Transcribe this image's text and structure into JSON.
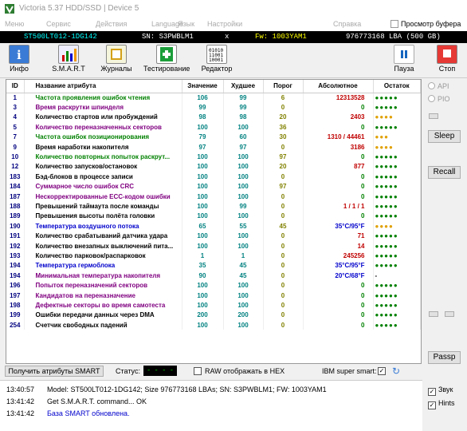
{
  "window": {
    "title": "Victoria 5.37 HDD/SSD | Device 5"
  },
  "menu": {
    "items": [
      "Меню",
      "Сервис",
      "Действия",
      "Язык",
      "Language",
      "Настройки",
      "Справка"
    ],
    "viewer_label": "Просмотр буфера"
  },
  "device": {
    "model": "ST500LT012-1DG142",
    "serial": "SN: S3PWBLM1",
    "close": "x",
    "firmware": "Fw: 1003YAM1",
    "capacity": "976773168 LBA (500 GB)"
  },
  "toolbar": {
    "info": "Инфо",
    "smart": "S.M.A.R.T",
    "journals": "Журналы",
    "testing": "Тестирование",
    "editor": "Редактор",
    "pause": "Пауза",
    "stop": "Стоп"
  },
  "smart_table": {
    "headers": [
      "ID",
      "Название атрибута",
      "Значение",
      "Худшее",
      "Порог",
      "Абсолютное",
      "Остаток"
    ],
    "rows": [
      {
        "id": "1",
        "name": "Частота проявления ошибок чтения",
        "value": "106",
        "worst": "99",
        "threshold": "6",
        "raw": "12313528",
        "status": "●●●●●",
        "name_color": "#008000",
        "status_color": "#008000"
      },
      {
        "id": "3",
        "name": "Время раскрутки шпинделя",
        "value": "99",
        "worst": "99",
        "threshold": "0",
        "raw": "0",
        "status": "●●●●●",
        "name_color": "#800080",
        "status_color": "#008000"
      },
      {
        "id": "4",
        "name": "Количество стартов или пробуждений",
        "value": "98",
        "worst": "98",
        "threshold": "20",
        "raw": "2403",
        "status": "●●●●",
        "name_color": "#000000",
        "status_color": "#e0a000"
      },
      {
        "id": "5",
        "name": "Количество переназначенных секторов",
        "value": "100",
        "worst": "100",
        "threshold": "36",
        "raw": "0",
        "status": "●●●●●",
        "name_color": "#800080",
        "status_color": "#008000"
      },
      {
        "id": "7",
        "name": "Частота ошибок позиционирования",
        "value": "79",
        "worst": "60",
        "threshold": "30",
        "raw": "1310 / 44461",
        "status": "●●●",
        "name_color": "#008000",
        "status_color": "#e0a000"
      },
      {
        "id": "9",
        "name": "Время наработки накопителя",
        "value": "97",
        "worst": "97",
        "threshold": "0",
        "raw": "3186",
        "status": "●●●●",
        "name_color": "#000000",
        "status_color": "#e0a000"
      },
      {
        "id": "10",
        "name": "Количество повторных попыток раскрут...",
        "value": "100",
        "worst": "100",
        "threshold": "97",
        "raw": "0",
        "status": "●●●●●",
        "name_color": "#008000",
        "status_color": "#008000"
      },
      {
        "id": "12",
        "name": "Количество запусков/остановок",
        "value": "100",
        "worst": "100",
        "threshold": "20",
        "raw": "877",
        "status": "●●●●●",
        "name_color": "#000000",
        "status_color": "#008000"
      },
      {
        "id": "183",
        "name": "Бэд-блоков в процессе записи",
        "value": "100",
        "worst": "100",
        "threshold": "0",
        "raw": "0",
        "status": "●●●●●",
        "name_color": "#000000",
        "status_color": "#008000"
      },
      {
        "id": "184",
        "name": "Суммарное число ошибок CRC",
        "value": "100",
        "worst": "100",
        "threshold": "97",
        "raw": "0",
        "status": "●●●●●",
        "name_color": "#800080",
        "status_color": "#008000"
      },
      {
        "id": "187",
        "name": "Нескорректированные ECC-кодом ошибки",
        "value": "100",
        "worst": "100",
        "threshold": "0",
        "raw": "0",
        "status": "●●●●●",
        "name_color": "#800080",
        "status_color": "#008000"
      },
      {
        "id": "188",
        "name": "Превышений таймаута после команды",
        "value": "100",
        "worst": "99",
        "threshold": "0",
        "raw": "1 / 1 / 1",
        "status": "●●●●●",
        "name_color": "#000000",
        "status_color": "#008000"
      },
      {
        "id": "189",
        "name": "Превышения высоты полёта головки",
        "value": "100",
        "worst": "100",
        "threshold": "0",
        "raw": "0",
        "status": "●●●●●",
        "name_color": "#000000",
        "status_color": "#008000"
      },
      {
        "id": "190",
        "name": "Температура воздушного потока",
        "value": "65",
        "worst": "55",
        "threshold": "45",
        "raw": "35°C/95°F",
        "status": "●●●●",
        "name_color": "#0000cc",
        "status_color": "#e0a000"
      },
      {
        "id": "191",
        "name": "Количество срабатываний датчика удара",
        "value": "100",
        "worst": "100",
        "threshold": "0",
        "raw": "71",
        "status": "●●●●●",
        "name_color": "#000000",
        "status_color": "#008000"
      },
      {
        "id": "192",
        "name": "Количество внезапных выключений пита...",
        "value": "100",
        "worst": "100",
        "threshold": "0",
        "raw": "14",
        "status": "●●●●●",
        "name_color": "#000000",
        "status_color": "#008000"
      },
      {
        "id": "193",
        "name": "Количество парковок/распарковок",
        "value": "1",
        "worst": "1",
        "threshold": "0",
        "raw": "245256",
        "status": "●●●●●",
        "name_color": "#000000",
        "status_color": "#008000"
      },
      {
        "id": "194",
        "name": "Температура гермоблока",
        "value": "35",
        "worst": "45",
        "threshold": "0",
        "raw": "35°C/95°F",
        "status": "●●●●●",
        "name_color": "#0000cc",
        "status_color": "#008000"
      },
      {
        "id": "194",
        "name": "Минимальная температура накопителя",
        "value": "90",
        "worst": "45",
        "threshold": "0",
        "raw": "20°C/68°F",
        "status": "-",
        "name_color": "#800080",
        "status_color": "#000000"
      },
      {
        "id": "196",
        "name": "Попыток переназначений секторов",
        "value": "100",
        "worst": "100",
        "threshold": "0",
        "raw": "0",
        "status": "●●●●●",
        "name_color": "#800080",
        "status_color": "#008000"
      },
      {
        "id": "197",
        "name": "Кандидатов на переназначение",
        "value": "100",
        "worst": "100",
        "threshold": "0",
        "raw": "0",
        "status": "●●●●●",
        "name_color": "#800080",
        "status_color": "#008000"
      },
      {
        "id": "198",
        "name": "Дефектные секторы во время самотеста",
        "value": "100",
        "worst": "100",
        "threshold": "0",
        "raw": "0",
        "status": "●●●●●",
        "name_color": "#800080",
        "status_color": "#008000"
      },
      {
        "id": "199",
        "name": "Ошибки передачи данных через DMA",
        "value": "200",
        "worst": "200",
        "threshold": "0",
        "raw": "0",
        "status": "●●●●●",
        "name_color": "#000000",
        "status_color": "#008000"
      },
      {
        "id": "254",
        "name": "Счетчик свободных падений",
        "value": "100",
        "worst": "100",
        "threshold": "0",
        "raw": "0",
        "status": "●●●●●",
        "name_color": "#000000",
        "status_color": "#008000"
      }
    ]
  },
  "sidebar": {
    "api": "API",
    "pio": "PIO",
    "sleep": "Sleep",
    "recall": "Recall",
    "passp": "Passp"
  },
  "bottom": {
    "get_smart": "Получить атрибуты SMART",
    "status_label": "Статус:",
    "status_value": "- - - - -",
    "raw_hex": "RAW отображать в HEX",
    "ibm_label": "IBM super smart:"
  },
  "log": [
    {
      "time": "13:40:57",
      "text": "Model: ST500LT012-1DG142; Size 976773168 LBAs; SN: S3PWBLM1; FW: 1003YAM1",
      "color": "#000000"
    },
    {
      "time": "13:41:42",
      "text": "Get S.M.A.R.T. command... OK",
      "color": "#000000"
    },
    {
      "time": "13:41:42",
      "text": "База SMART обновлена.",
      "color": "#0000cc"
    }
  ],
  "log_options": {
    "sound": "Звук",
    "hints": "Hints"
  },
  "colors": {
    "device_model": "#00ffff",
    "device_serial": "#ffffff",
    "device_fw": "#ffff00",
    "device_capacity": "#ffffff"
  }
}
